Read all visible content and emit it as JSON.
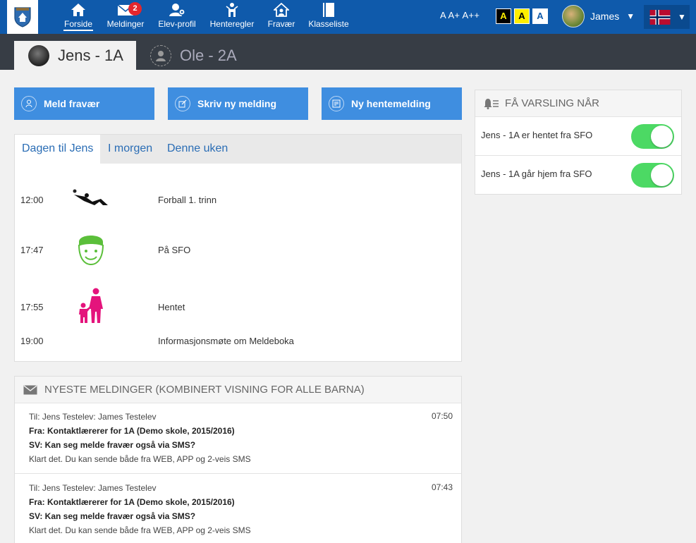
{
  "nav": {
    "items": [
      {
        "label": "Forside",
        "icon": "home-icon",
        "active": true
      },
      {
        "label": "Meldinger",
        "icon": "envelope-icon",
        "badge": "2"
      },
      {
        "label": "Elev-profil",
        "icon": "student-profile-icon"
      },
      {
        "label": "Henteregler",
        "icon": "pickup-rules-icon"
      },
      {
        "label": "Fravær",
        "icon": "absence-icon"
      },
      {
        "label": "Klasseliste",
        "icon": "class-list-icon"
      }
    ],
    "font_sizes": "A A+ A++",
    "contrast_options": [
      "A",
      "A",
      "A"
    ],
    "user_name": "James",
    "language": "Norwegian flag"
  },
  "children": [
    {
      "label": "Jens - 1A",
      "active": true
    },
    {
      "label": "Ole - 2A",
      "active": false
    }
  ],
  "actions": [
    {
      "label": "Meld fravær",
      "icon": "person-icon"
    },
    {
      "label": "Skriv ny melding",
      "icon": "write-icon"
    },
    {
      "label": "Ny hentemelding",
      "icon": "pickup-icon"
    }
  ],
  "day": {
    "tabs": [
      "Dagen til Jens",
      "I morgen",
      "Denne uken"
    ],
    "events": [
      {
        "time": "12:00",
        "name": "Forball 1. trinn",
        "icon": "football-player-icon"
      },
      {
        "time": "17:47",
        "name": "På SFO",
        "icon": "child-face-icon"
      },
      {
        "time": "17:55",
        "name": "Hentet",
        "icon": "parent-child-icon"
      },
      {
        "time": "19:00",
        "name": "Informasjonsmøte om Meldeboka",
        "icon": ""
      }
    ]
  },
  "messages": {
    "title": "NYESTE MELDINGER (KOMBINERT VISNING FOR ALLE BARNA)",
    "items": [
      {
        "to": "Til: Jens Testelev: James Testelev",
        "time": "07:50",
        "from": "Fra: Kontaktlærerer for 1A (Demo skole, 2015/2016)",
        "subject": "SV: Kan seg melde fravær også via SMS?",
        "body": "Klart det. Du kan sende både fra WEB, APP og 2-veis SMS"
      },
      {
        "to": "Til: Jens Testelev: James Testelev",
        "time": "07:43",
        "from": "Fra: Kontaktlærerer for 1A (Demo skole, 2015/2016)",
        "subject": "SV: Kan seg melde fravær også via SMS?",
        "body": "Klart det. Du kan sende både fra WEB, APP og 2-veis SMS"
      }
    ]
  },
  "notify": {
    "title": "FÅ VARSLING NÅR",
    "rows": [
      {
        "label": "Jens - 1A er hentet fra SFO",
        "on": true
      },
      {
        "label": "Jens - 1A går hjem fra SFO",
        "on": true
      }
    ]
  },
  "colors": {
    "topbar": "#0f5aab",
    "childbar": "#373d45",
    "action": "#3f8ee0",
    "toggle": "#4cd964",
    "badge": "#e4262c",
    "pink": "#e4147c",
    "green": "#5bbf3a"
  }
}
